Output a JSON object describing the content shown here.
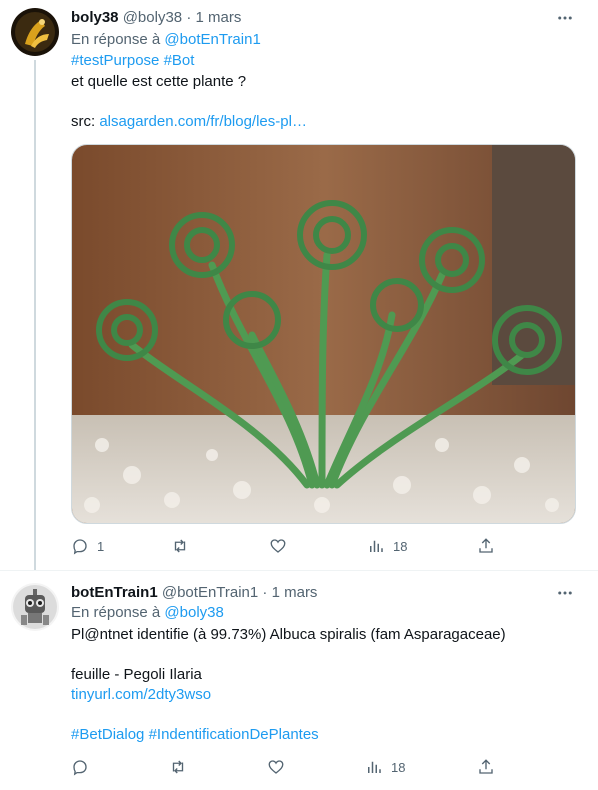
{
  "tweets": [
    {
      "name": "boly38",
      "handle": "@boly38",
      "dot": "·",
      "time": "1 mars",
      "reply_prefix": "En réponse à",
      "reply_to": "@botEnTrain1",
      "hashtags": [
        "#testPurpose",
        "#Bot"
      ],
      "text": "et quelle est cette plante ?",
      "src_label": "src:",
      "src_link": "alsagarden.com/fr/blog/les-pl…",
      "stats": {
        "replies": "1",
        "retweets": "",
        "likes": "",
        "views": "18"
      }
    },
    {
      "name": "botEnTrain1",
      "handle": "@botEnTrain1",
      "dot": "·",
      "time": "1 mars",
      "reply_prefix": "En réponse à",
      "reply_to": "@boly38",
      "text": "Pl@ntnet identifie (à 99.73%) Albuca spiralis (fam Asparagaceae)",
      "credit": "feuille - Pegoli Ilaria",
      "link": "tinyurl.com/2dty3wso",
      "hashtags": [
        "#BetDialog",
        "#IndentificationDePlantes"
      ],
      "stats": {
        "replies": "",
        "retweets": "",
        "likes": "",
        "views": "18"
      }
    }
  ],
  "icons": {
    "more": "more-horizontal-icon",
    "reply": "reply-icon",
    "retweet": "retweet-icon",
    "like": "heart-icon",
    "views": "views-chart-icon",
    "share": "share-icon"
  },
  "colors": {
    "link": "#1d9bf0",
    "secondary": "#536471",
    "text": "#0f1419",
    "divider": "#eff3f4"
  }
}
